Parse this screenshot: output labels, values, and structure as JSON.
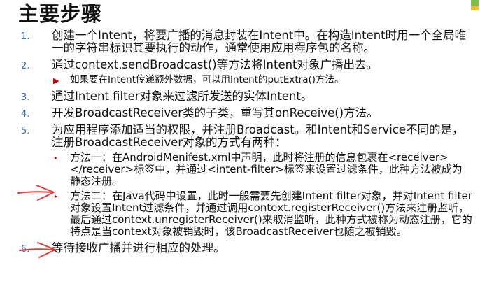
{
  "title": "主要步骤",
  "items": [
    {
      "num": "1.",
      "text": "创建一个Intent，将要广播的消息封装在Intent中。在构造Intent时用一个全局唯一的字符串标识其要执行的动作，通常使用应用程序包的名称。"
    },
    {
      "num": "2.",
      "text": "通过context.sendBroadcast()等方法将Intent对象广播出去。"
    },
    {
      "num": "3.",
      "text": "通过Intent filter对象来过滤所发送的实体Intent。"
    },
    {
      "num": "4.",
      "text": "开发BroadcastReceiver类的子类，重写其onReceive()方法。"
    },
    {
      "num": "5.",
      "text": "为应用程序添加适当的权限，并注册Broadcast。和Intent和Service不同的是，注册BroadcastReceiver对象的方式有两种："
    },
    {
      "num": "6.",
      "text": "等待接收广播并进行相应的处理。"
    }
  ],
  "sub_items": {
    "item2": "如果要在Intent传递额外数据，可以用Intent的putExtra()方法。",
    "item5_a": "方法一：在AndroidMenifest.xml中声明，此时将注册的信息包裹在<receiver> </receiver>标签中，并通过<intent-filter>标签来设置过滤条件，此种方法被成为静态注册。",
    "item5_b": "方法二：在Java代码中设置，此时一般需要先创建Intent filter对象，并对Intent filter对象设置Intent过滤条件，并通过调用context.registerReceiver()方法来注册监听，最后通过context.unregisterReceiver()来取消监听，此种方式被称为动态注册，它的特点是当context对象被销毁时，该BroadcastReceiver也随之被销毁。"
  },
  "colors": {
    "number": "#3f6ebf",
    "bullet": "#c00000",
    "arrow": "#e23b3b"
  },
  "icons": [
    "bullet-triangle-icon",
    "bullet-dot-icon",
    "red-arrow-icon",
    "corner-logo-icon"
  ]
}
